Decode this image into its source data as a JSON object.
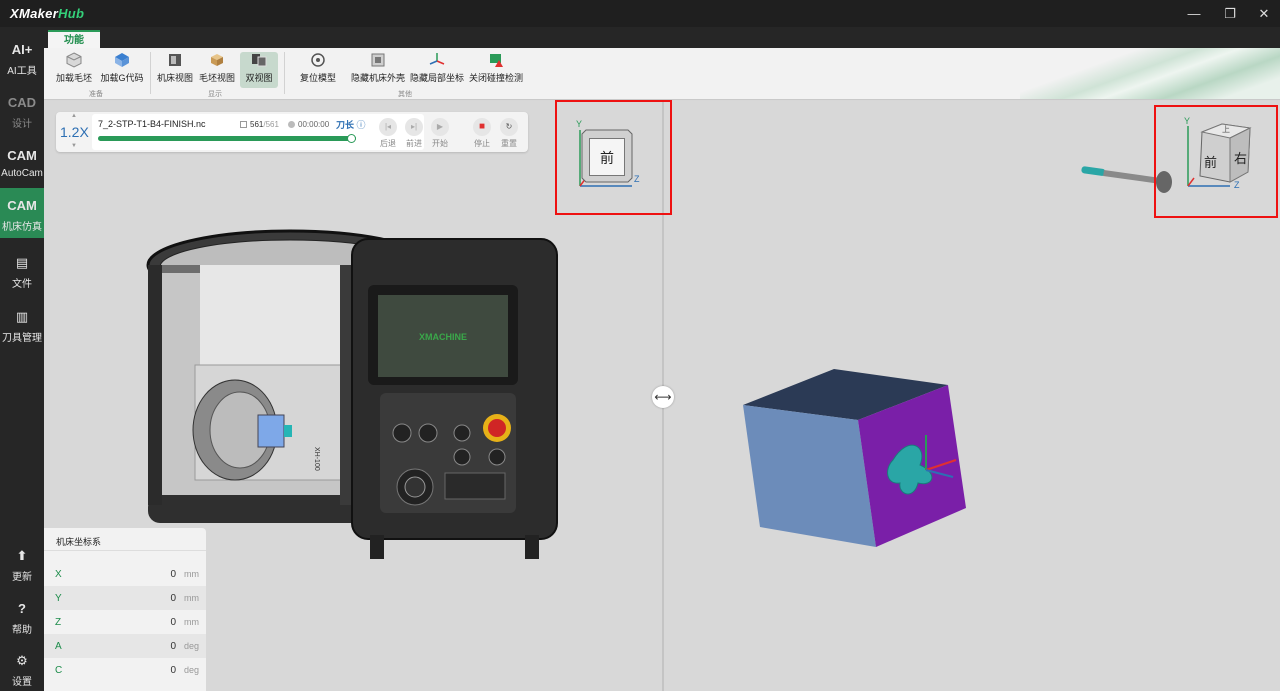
{
  "app": {
    "logo_main": "XMaker",
    "logo_hub": "Hub"
  },
  "window": {
    "minimize": "—",
    "restore": "❐",
    "close": "✕"
  },
  "sidebar": {
    "items": [
      {
        "icon": "AI+",
        "label": "AI工具"
      },
      {
        "icon": "CAD",
        "label": "设计"
      },
      {
        "icon": "CAM",
        "label": "AutoCam"
      },
      {
        "icon": "CAM",
        "label": "机床仿真"
      },
      {
        "icon": "▤",
        "label": "文件"
      },
      {
        "icon": "▥",
        "label": "刀具管理"
      },
      {
        "icon": "⬆",
        "label": "更新"
      },
      {
        "icon": "?",
        "label": "帮助"
      },
      {
        "icon": "⚙",
        "label": "设置"
      }
    ]
  },
  "ribbon": {
    "tab": "功能",
    "buttons": [
      "加载毛坯",
      "加载G代码",
      "机床视图",
      "毛坯视图",
      "双视图",
      "复位模型",
      "隐藏机床外壳",
      "隐藏局部坐标",
      "关闭碰撞检测"
    ],
    "groups": [
      "准备",
      "显示",
      "其他"
    ]
  },
  "playback": {
    "speed": "1.2X",
    "file_name": "7_2-STP-T1-B4-FINISH.nc",
    "line_current": "561",
    "line_total": "/561",
    "time": "00:00:00",
    "tool_label": "刀长",
    "progress": 1.0,
    "controls": [
      "后退",
      "前进",
      "开始",
      "停止",
      "重置"
    ]
  },
  "viewcube_left": {
    "face": "前",
    "axis_y": "Y",
    "axis_z": "Z"
  },
  "viewcube_right": {
    "face_front": "前",
    "face_right": "右",
    "face_top": "上",
    "axis_y": "Y",
    "axis_z": "Z"
  },
  "machine": {
    "screen_brand": "XMACHINE",
    "side_label": "XH-100"
  },
  "coords": {
    "title": "机床坐标系",
    "rows": [
      {
        "axis": "X",
        "value": "0",
        "unit": "mm"
      },
      {
        "axis": "Y",
        "value": "0",
        "unit": "mm"
      },
      {
        "axis": "Z",
        "value": "0",
        "unit": "mm"
      },
      {
        "axis": "A",
        "value": "0",
        "unit": "deg"
      },
      {
        "axis": "C",
        "value": "0",
        "unit": "deg"
      }
    ]
  },
  "swap_icon": "⟷",
  "colors": {
    "accent": "#2a9a58",
    "link": "#2d6fb3",
    "highlight_box": "#e11111",
    "stock_front": "#6c8cba",
    "stock_side": "#7a1fa8",
    "stock_top": "#2b3a55",
    "part": "#2aa6a6"
  }
}
